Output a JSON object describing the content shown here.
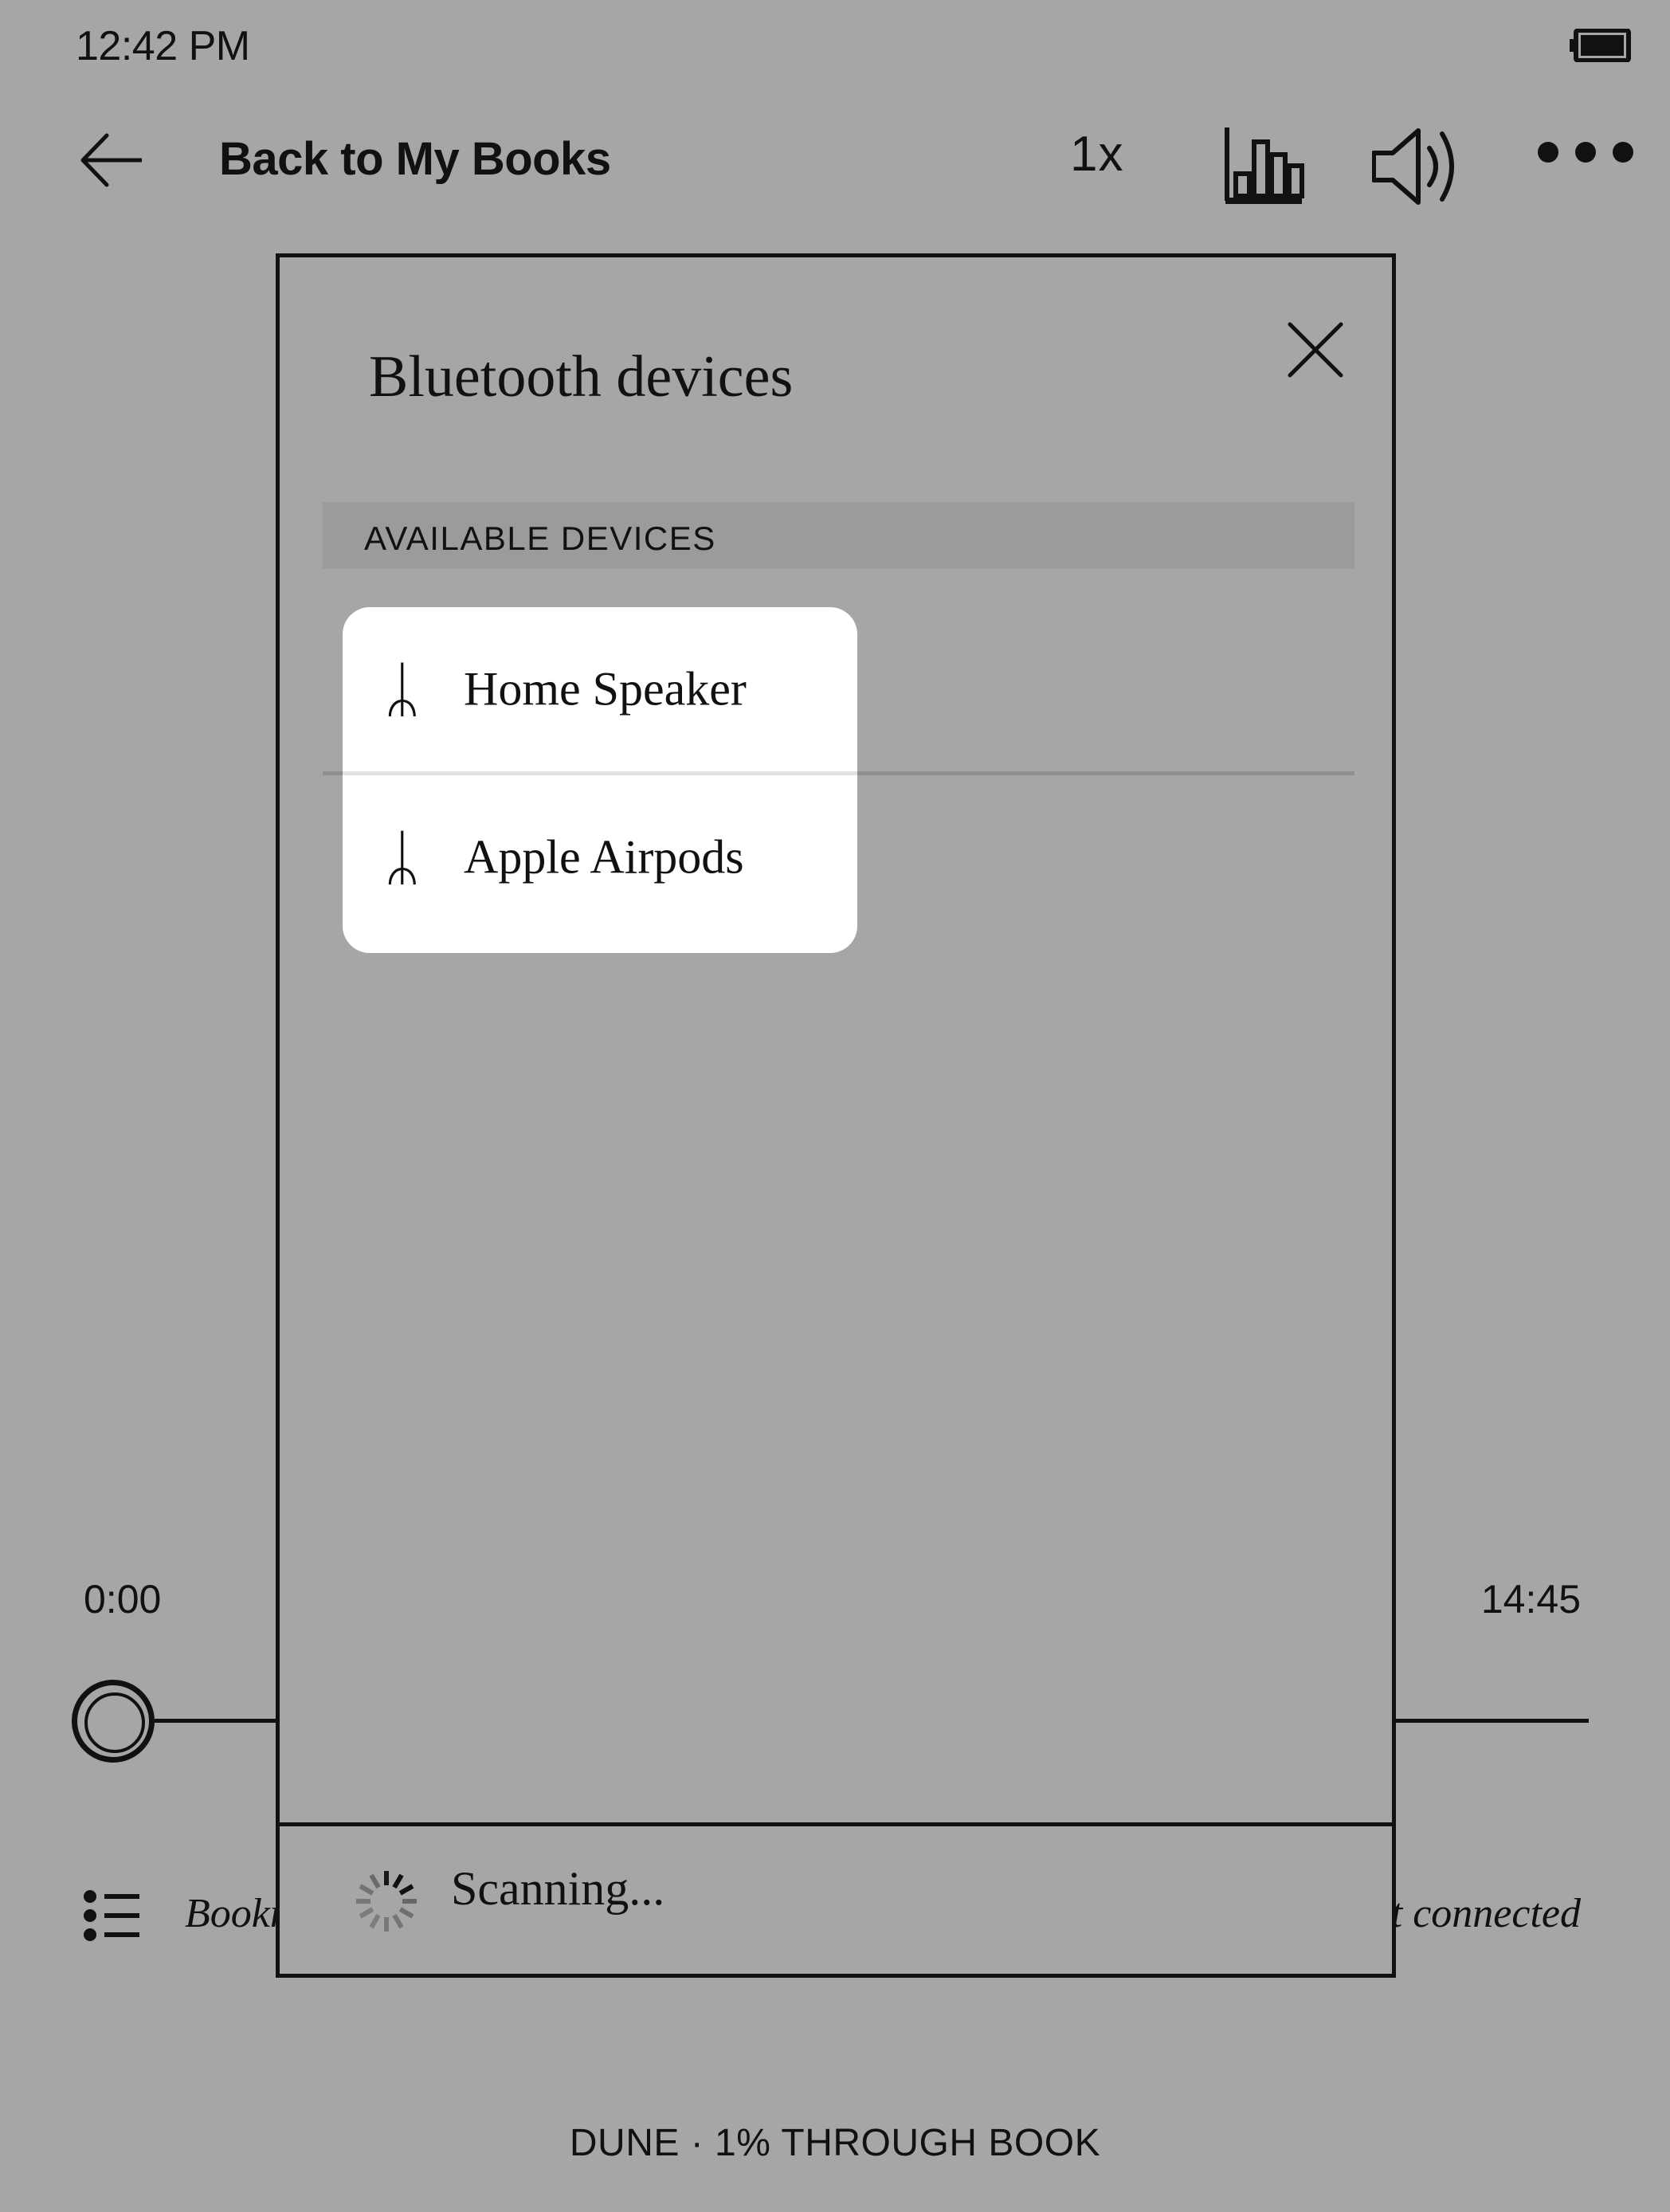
{
  "status_bar": {
    "clock": "12:42 PM",
    "battery_icon": "battery-full-icon"
  },
  "toolbar": {
    "back_icon": "arrow-left-icon",
    "title": "Back to My Books",
    "speed_label": "1x",
    "equalizer_icon": "equalizer-icon",
    "volume_icon": "volume-speaker-icon",
    "more_icon": "more-horizontal-icon"
  },
  "player": {
    "time_elapsed": "0:00",
    "time_total": "14:45",
    "bookmarks_icon": "bulleted-list-icon",
    "bookmarks_label": "Bookmarks",
    "connection_status": "Not connected",
    "book_footer": "DUNE · 1% THROUGH BOOK"
  },
  "dialog": {
    "title": "Bluetooth devices",
    "close_icon": "close-x-icon",
    "section_header": "AVAILABLE DEVICES",
    "devices": [
      {
        "name": "Home Speaker",
        "icon": "bluetooth-icon",
        "glyph": "ᛦ"
      },
      {
        "name": "Apple Airpods",
        "icon": "bluetooth-icon",
        "glyph": "ᛦ"
      }
    ],
    "footer": {
      "spinner_icon": "loading-spinner-icon",
      "label": "Scanning..."
    }
  },
  "colors": {
    "page_background": "#a6a6a6",
    "dialog_background": "#a6a6a6",
    "section_band": "#9b9b9b",
    "card_background": "#ffffff",
    "ink": "#111111",
    "divider": "#8f8f8f"
  }
}
